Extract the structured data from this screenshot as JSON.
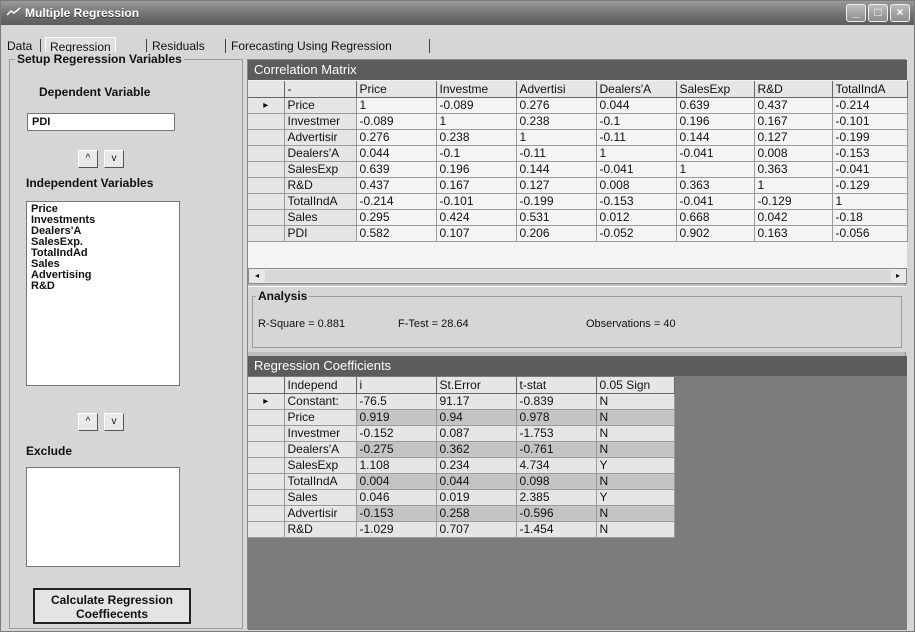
{
  "window": {
    "title": "Multiple Regression"
  },
  "tabs": [
    "Data",
    "Regression",
    "Residuals",
    "Forecasting Using Regression"
  ],
  "left": {
    "group_title": "Setup Regeression Variables",
    "dependent_label": "Dependent Variable",
    "dependent_value": "PDI",
    "independent_label": "Independent Variables",
    "independent_items": [
      "Price",
      "Investments",
      "Dealers'A",
      "SalesExp.",
      "TotalIndAd",
      "Sales",
      "Advertising",
      "R&D"
    ],
    "exclude_label": "Exclude",
    "up_symbol": "^",
    "down_symbol": "v",
    "calc_button_line1": "Calculate Regression",
    "calc_button_line2": "Coeffiecents"
  },
  "correlation": {
    "title": "Correlation Matrix",
    "row_marker": "▸",
    "columns": [
      "-",
      "Price",
      "Investme",
      "Advertisi",
      "Dealers'A",
      "SalesExp",
      "R&D",
      "TotalIndA"
    ],
    "rows": [
      [
        "Price",
        "1",
        "-0.089",
        "0.276",
        "0.044",
        "0.639",
        "0.437",
        "-0.214"
      ],
      [
        "Investmer",
        "-0.089",
        "1",
        "0.238",
        "-0.1",
        "0.196",
        "0.167",
        "-0.101"
      ],
      [
        "Advertisir",
        "0.276",
        "0.238",
        "1",
        "-0.11",
        "0.144",
        "0.127",
        "-0.199"
      ],
      [
        "Dealers'A",
        "0.044",
        "-0.1",
        "-0.11",
        "1",
        "-0.041",
        "0.008",
        "-0.153"
      ],
      [
        "SalesExp",
        "0.639",
        "0.196",
        "0.144",
        "-0.041",
        "1",
        "0.363",
        "-0.041"
      ],
      [
        "R&D",
        "0.437",
        "0.167",
        "0.127",
        "0.008",
        "0.363",
        "1",
        "-0.129"
      ],
      [
        "TotalIndA",
        "-0.214",
        "-0.101",
        "-0.199",
        "-0.153",
        "-0.041",
        "-0.129",
        "1"
      ],
      [
        "Sales",
        "0.295",
        "0.424",
        "0.531",
        "0.012",
        "0.668",
        "0.042",
        "-0.18"
      ],
      [
        "PDI",
        "0.582",
        "0.107",
        "0.206",
        "-0.052",
        "0.902",
        "0.163",
        "-0.056"
      ]
    ]
  },
  "analysis": {
    "title": "Analysis",
    "r_square": "R-Square = 0.881",
    "f_test": "F-Test = 28.64",
    "observations": "Observations = 40"
  },
  "regression": {
    "title": "Regression Coefficients",
    "row_marker": "▸",
    "columns": [
      "Independ",
      "i",
      "St.Error",
      "t-stat",
      "0.05 Sign"
    ],
    "rows": [
      [
        "Constant:",
        "-76.5",
        "91.17",
        "-0.839",
        "N"
      ],
      [
        "Price",
        "0.919",
        "0.94",
        "0.978",
        "N"
      ],
      [
        "Investmer",
        "-0.152",
        "0.087",
        "-1.753",
        "N"
      ],
      [
        "Dealers'A",
        "-0.275",
        "0.362",
        "-0.761",
        "N"
      ],
      [
        "SalesExp",
        "1.108",
        "0.234",
        "4.734",
        "Y"
      ],
      [
        "TotalIndA",
        "0.004",
        "0.044",
        "0.098",
        "N"
      ],
      [
        "Sales",
        "0.046",
        "0.019",
        "2.385",
        "Y"
      ],
      [
        "Advertisir",
        "-0.153",
        "0.258",
        "-0.596",
        "N"
      ],
      [
        "R&D",
        "-1.029",
        "0.707",
        "-1.454",
        "N"
      ]
    ]
  }
}
